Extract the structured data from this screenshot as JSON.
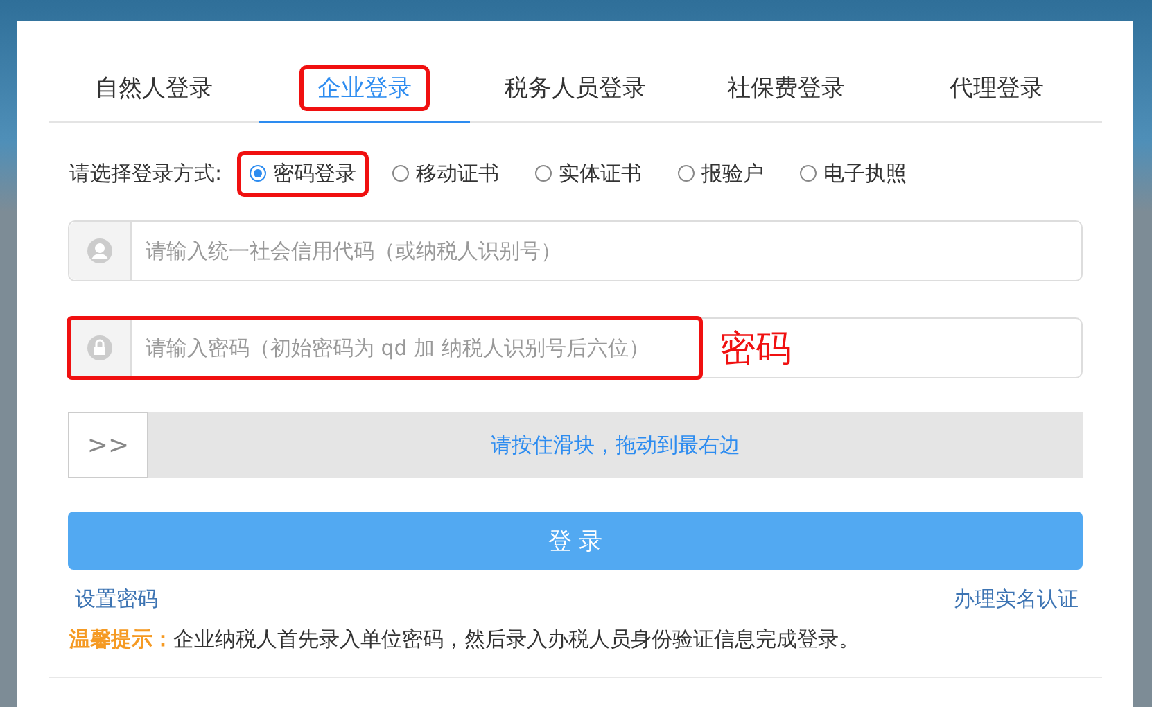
{
  "tabs": [
    {
      "label": "自然人登录",
      "selected": false,
      "annotated": false
    },
    {
      "label": "企业登录",
      "selected": true,
      "annotated": true
    },
    {
      "label": "税务人员登录",
      "selected": false,
      "annotated": false
    },
    {
      "label": "社保费登录",
      "selected": false,
      "annotated": false
    },
    {
      "label": "代理登录",
      "selected": false,
      "annotated": false
    }
  ],
  "login_method": {
    "label": "请选择登录方式:",
    "options": [
      {
        "label": "密码登录",
        "selected": true,
        "annotated": true
      },
      {
        "label": "移动证书",
        "selected": false,
        "annotated": false
      },
      {
        "label": "实体证书",
        "selected": false,
        "annotated": false
      },
      {
        "label": "报验户",
        "selected": false,
        "annotated": false
      },
      {
        "label": "电子执照",
        "selected": false,
        "annotated": false
      }
    ]
  },
  "fields": [
    {
      "kind": "user",
      "placeholder": "请输入统一社会信用代码（或纳税人识别号）",
      "annotated": false
    },
    {
      "kind": "lock",
      "placeholder": "请输入密码（初始密码为 qd 加 纳税人识别号后六位）",
      "annotated": true,
      "note": "密码"
    }
  ],
  "slider": {
    "handle": ">>",
    "text": "请按住滑块，拖动到最右边"
  },
  "login_button": "登 录",
  "links": [
    "设置密码",
    "办理实名认证"
  ],
  "tip": {
    "label": "温馨提示：",
    "text": "企业纳税人首先录入单位密码，然后录入办税人员身份验证信息完成登录。"
  }
}
